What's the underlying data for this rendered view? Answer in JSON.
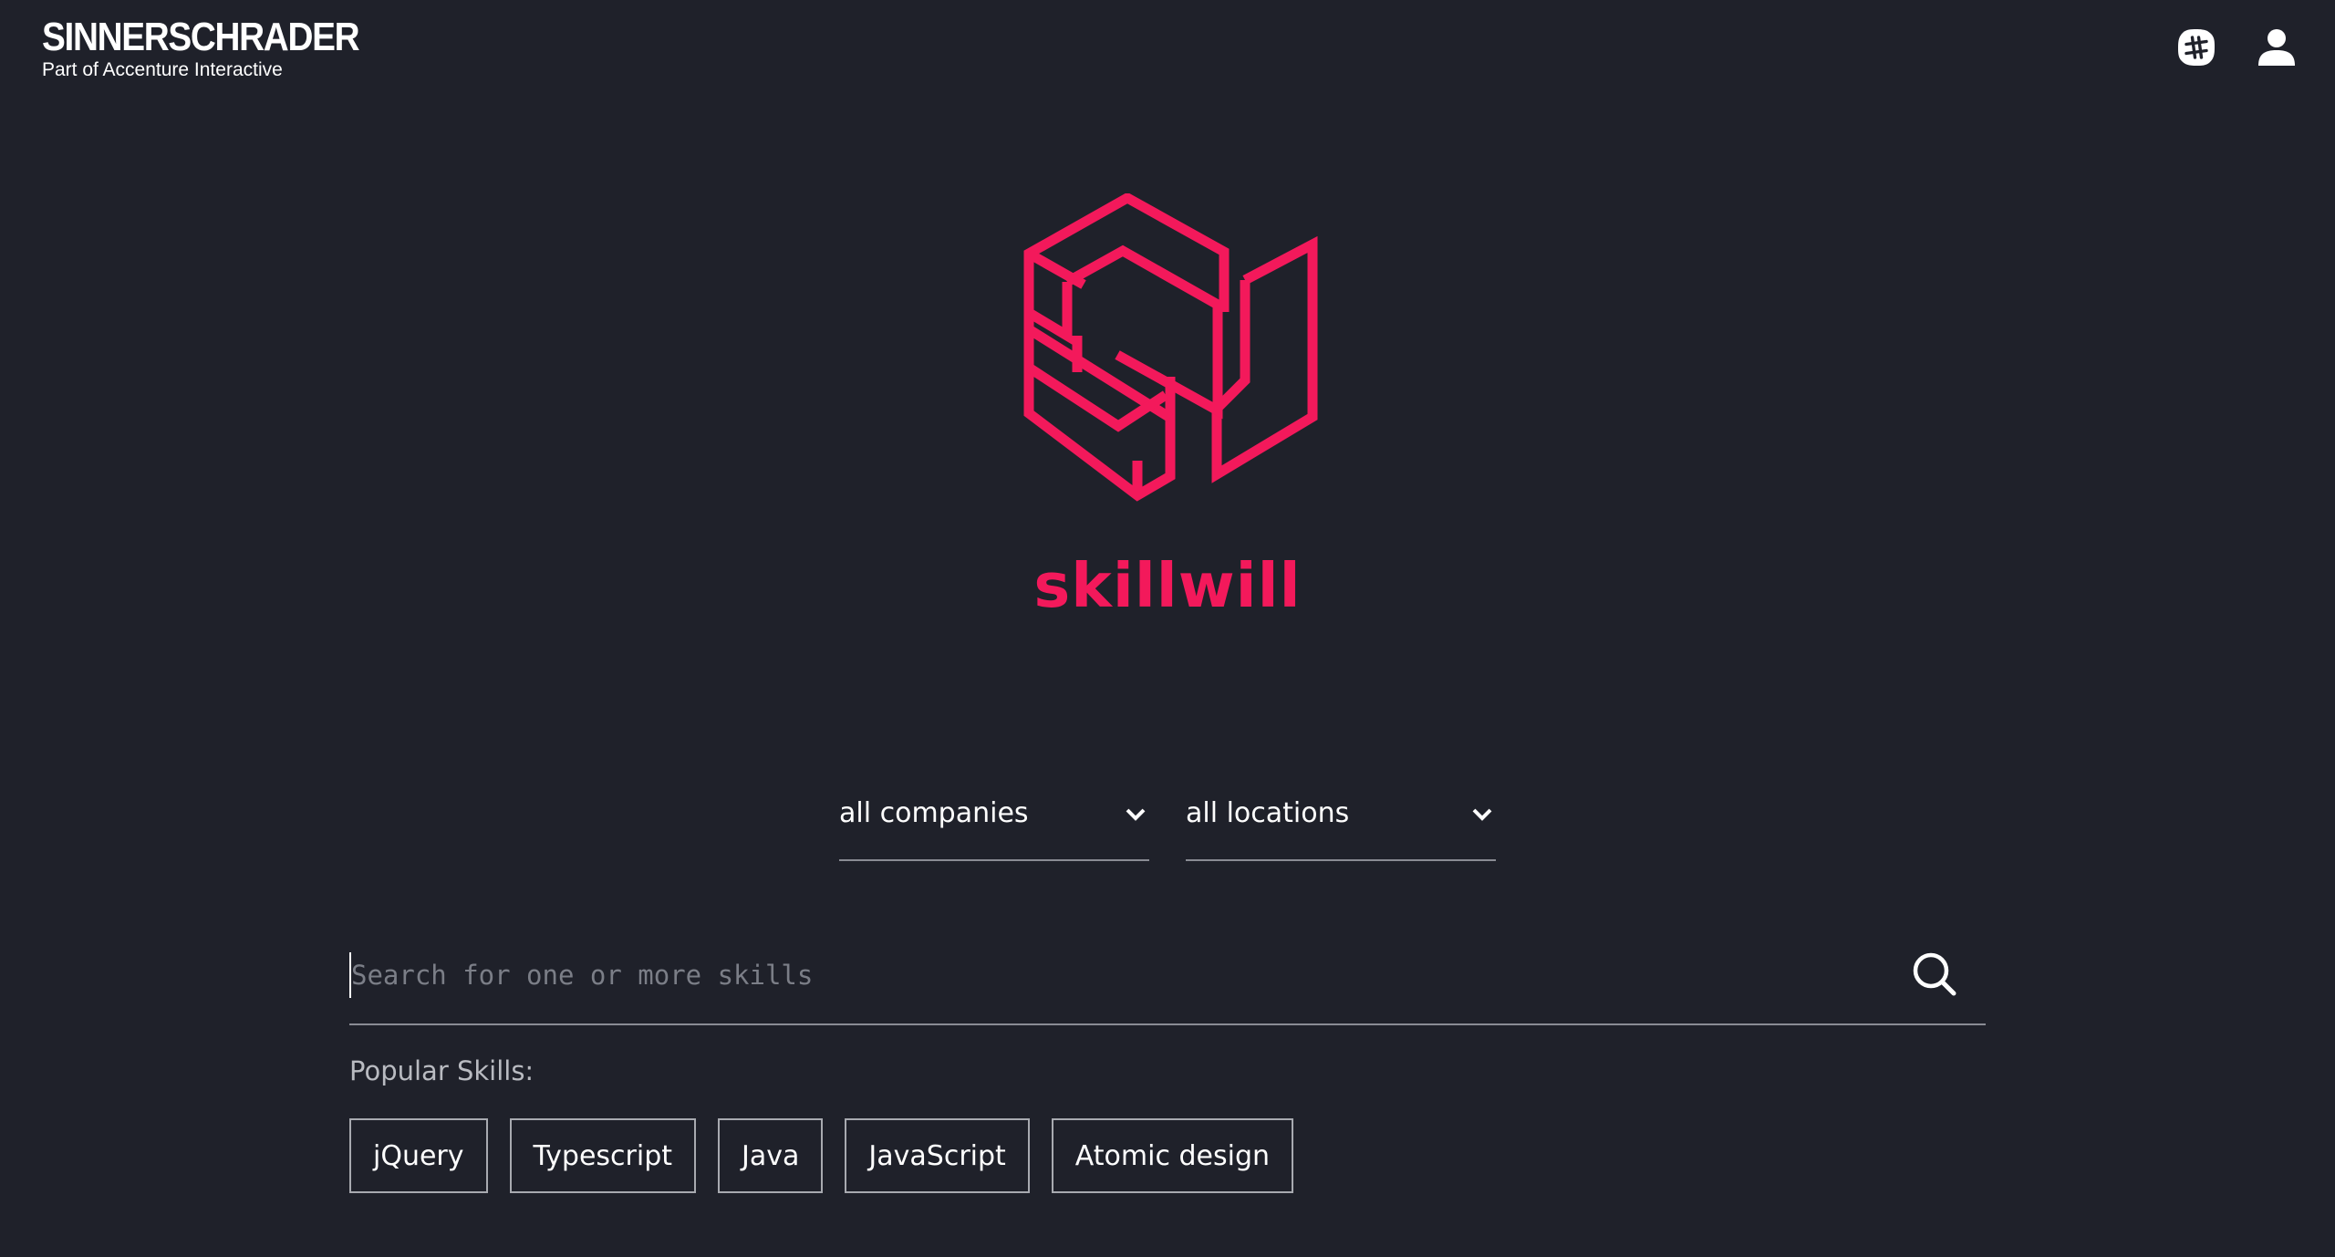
{
  "header": {
    "brand_name": "SINNERSCHRADER",
    "brand_subtitle": "Part of Accenture Interactive",
    "icons": [
      "slack-icon",
      "user-icon"
    ]
  },
  "app": {
    "title": "skillwill",
    "accent_color": "#f3195b",
    "background_color": "#1f212a"
  },
  "filters": {
    "company": "all companies",
    "location": "all locations"
  },
  "search": {
    "placeholder": "Search for one or more skills",
    "value": ""
  },
  "popular": {
    "label": "Popular Skills:",
    "skills": [
      "jQuery",
      "Typescript",
      "Java",
      "JavaScript",
      "Atomic design"
    ]
  }
}
